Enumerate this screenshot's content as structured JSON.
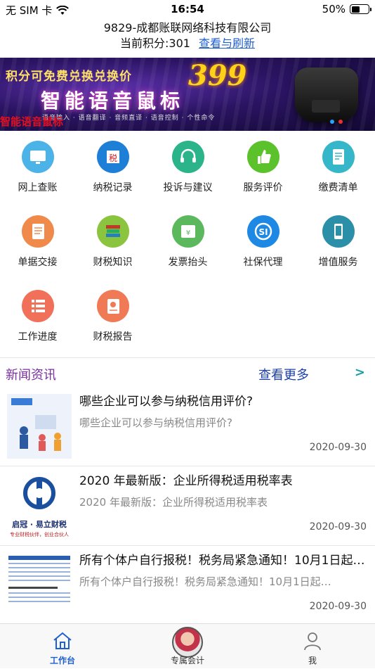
{
  "status_bar": {
    "carrier": "无 SIM 卡",
    "time": "16:54",
    "battery": "50%",
    "battery_level": 0.5
  },
  "header": {
    "company": "9829-成都账联网络科技有限公司",
    "points_label": "当前积分:301",
    "refresh_link": "查看与刷新"
  },
  "banner": {
    "top_text": "积分可免费兑换兑换价",
    "price": "399",
    "main_text": "智能语音鼠标",
    "features": "语音输入 · 语音翻译 · 音频直译 · 语音控制 · 个性命令",
    "caption": "智能语音鼠标"
  },
  "services": [
    {
      "label": "网上查账",
      "icon": "monitor-icon",
      "color": "#4bb3e8"
    },
    {
      "label": "纳税记录",
      "icon": "tax-record-icon",
      "color": "#1d7fd6"
    },
    {
      "label": "投诉与建议",
      "icon": "headset-icon",
      "color": "#2bb38a"
    },
    {
      "label": "服务评价",
      "icon": "thumbs-up-icon",
      "color": "#5cc22b"
    },
    {
      "label": "缴费清单",
      "icon": "bill-icon",
      "color": "#36b7c9"
    },
    {
      "label": "单据交接",
      "icon": "document-icon",
      "color": "#f08a4b"
    },
    {
      "label": "财税知识",
      "icon": "books-icon",
      "color": "#8bc53f"
    },
    {
      "label": "发票抬头",
      "icon": "invoice-icon",
      "color": "#5cb85c"
    },
    {
      "label": "社保代理",
      "icon": "social-security-icon",
      "color": "#1e88e5"
    },
    {
      "label": "增值服务",
      "icon": "phone-hand-icon",
      "color": "#2b8fa8"
    },
    {
      "label": "工作进度",
      "icon": "progress-list-icon",
      "color": "#f0705a"
    },
    {
      "label": "财税报告",
      "icon": "report-icon",
      "color": "#f07a55"
    }
  ],
  "news": {
    "section_title": "新闻资讯",
    "more_link": "查看更多",
    "arrow": ">",
    "items": [
      {
        "title": "哪些企业可以参与纳税信用评价?",
        "summary": "哪些企业可以参与纳税信用评价?",
        "date": "2020-09-30",
        "thumb": "illustration-thumb"
      },
      {
        "title": "2020 年最新版：企业所得税适用税率表",
        "summary": "2020 年最新版：企业所得税适用税率表",
        "date": "2020-09-30",
        "thumb": "logo-thumb",
        "thumb_text": "启冠 · 易立财税",
        "thumb_sub": "专业财税伙伴，创业合伙人"
      },
      {
        "title": "所有个体户自行报税！税务局紧急通知！10月1日起…",
        "summary": "所有个体户自行报税！税务局紧急通知！10月1日起…",
        "date": "2020-09-30",
        "thumb": "table-thumb"
      }
    ]
  },
  "tabbar": {
    "home": "工作台",
    "accountant": "专属会计",
    "me": "我"
  }
}
